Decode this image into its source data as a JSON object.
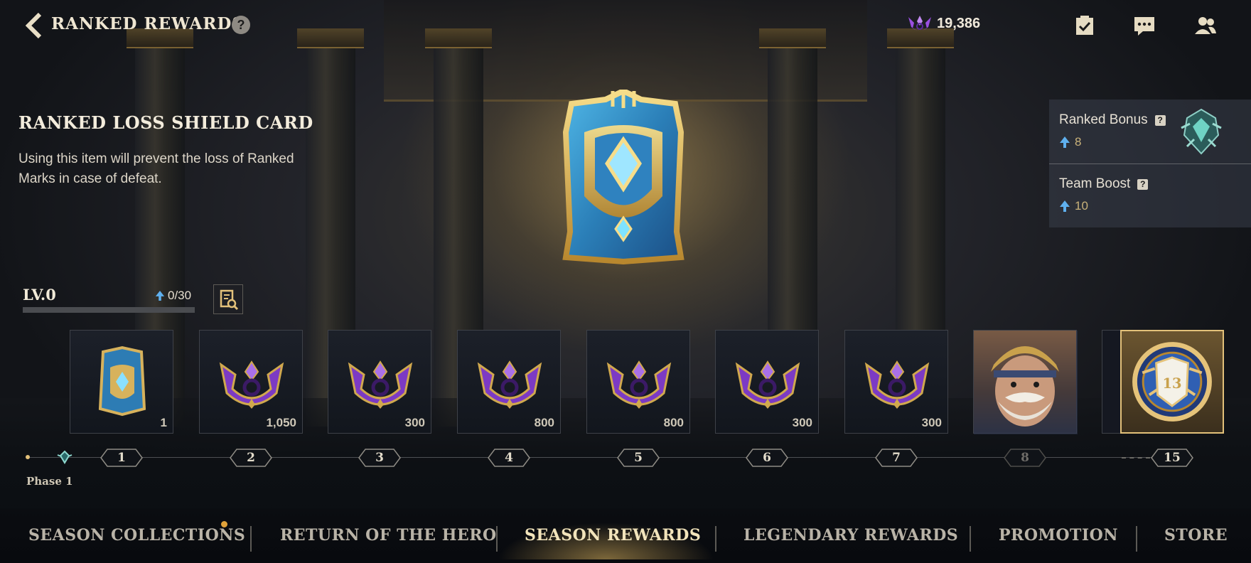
{
  "header": {
    "title": "RANKED REWARDS",
    "help_icon": "?",
    "currency_icon": "ranked-mark-icon",
    "currency_value": "19,386",
    "icons": [
      "missions-icon",
      "chat-icon",
      "friends-icon"
    ]
  },
  "item": {
    "name": "RANKED LOSS SHIELD CARD",
    "description": "Using this item will prevent the loss of Ranked Marks in case of defeat."
  },
  "bonuses": [
    {
      "label": "Ranked Bonus",
      "value": "8"
    },
    {
      "label": "Team Boost",
      "value": "10"
    }
  ],
  "level": {
    "label": "LV.0",
    "progress": "0/30",
    "progress_fraction": 0.0
  },
  "rewards": [
    {
      "type": "shield-card",
      "amount": "1",
      "level": "1"
    },
    {
      "type": "ranked-mark",
      "amount": "1,050",
      "level": "2"
    },
    {
      "type": "ranked-mark",
      "amount": "300",
      "level": "3"
    },
    {
      "type": "ranked-mark",
      "amount": "800",
      "level": "4"
    },
    {
      "type": "ranked-mark",
      "amount": "800",
      "level": "5"
    },
    {
      "type": "ranked-mark",
      "amount": "300",
      "level": "6"
    },
    {
      "type": "ranked-mark",
      "amount": "300",
      "level": "7"
    },
    {
      "type": "hero-portrait",
      "amount": "",
      "level": "8"
    },
    {
      "type": "emblem",
      "emblem_number": "13",
      "amount": "",
      "level": "15"
    }
  ],
  "phase_label": "Phase 1",
  "tabs": [
    {
      "label": "SEASON COLLECTIONS",
      "active": false,
      "notification": true
    },
    {
      "label": "RETURN OF THE HERO",
      "active": false
    },
    {
      "label": "SEASON REWARDS",
      "active": true
    },
    {
      "label": "LEGENDARY REWARDS",
      "active": false
    },
    {
      "label": "PROMOTION",
      "active": false
    },
    {
      "label": "STORE",
      "active": false
    }
  ],
  "colors": {
    "gold": "#c9b27a",
    "purple": "#8a3fd0",
    "active_tab": "#f2e4bb",
    "selected_border": "#e3c17a"
  }
}
